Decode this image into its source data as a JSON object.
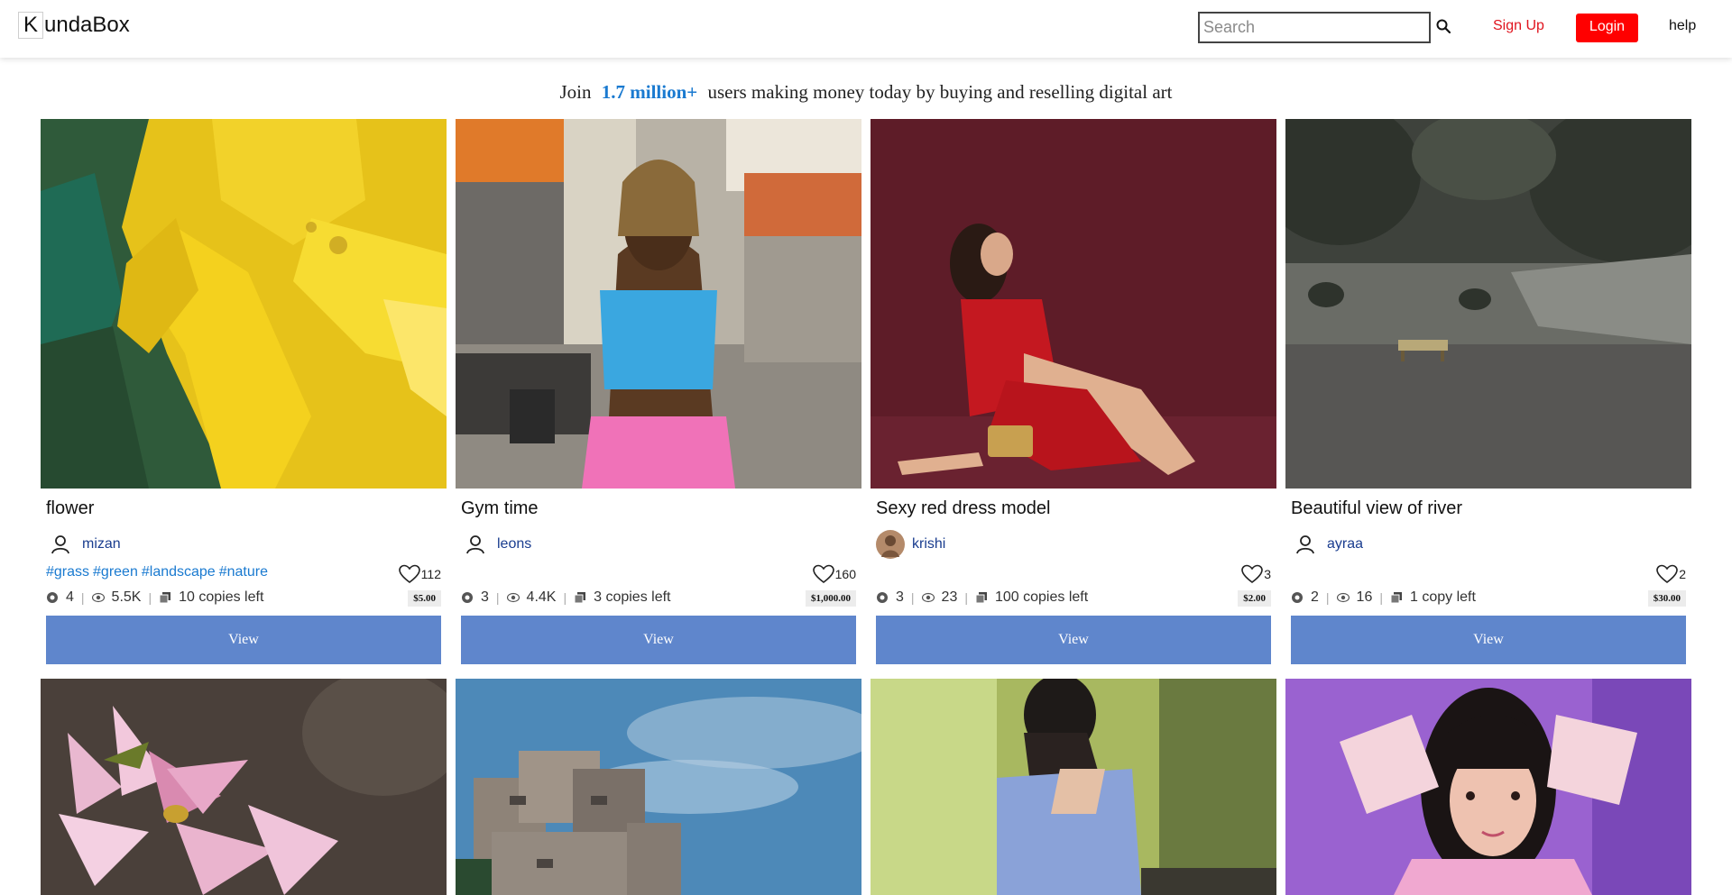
{
  "header": {
    "logo_letter": "K",
    "logo_rest": "undaBox",
    "search_placeholder": "Search",
    "signup_label": "Sign Up",
    "login_label": "Login",
    "help_label": "help"
  },
  "banner": {
    "prefix": "Join",
    "count": "1.7 million+",
    "suffix": "users making money today by buying and reselling digital art"
  },
  "colors": {
    "accent_blue": "#1a7ad0",
    "login_red": "#ff0000",
    "signup_red": "#e0141e",
    "view_button": "#5f86cc"
  },
  "cards": [
    {
      "title": "flower",
      "owner": "mizan",
      "owner_avatar": "user-icon",
      "tags": [
        "#grass",
        "#green",
        "#landscape",
        "#nature"
      ],
      "likes": "112",
      "resales": "4",
      "views": "5.5K",
      "copies": "10 copies left",
      "price": "$5.00",
      "view_label": "View",
      "image": "yellow flower photo"
    },
    {
      "title": "Gym time",
      "owner": "leons",
      "owner_avatar": "user-icon",
      "tags": [],
      "likes": "160",
      "resales": "3",
      "views": "4.4K",
      "copies": "3 copies left",
      "price": "$1,000.00",
      "view_label": "View",
      "image": "woman in gym photo"
    },
    {
      "title": "Sexy red dress model",
      "owner": "krishi",
      "owner_avatar": "profile-photo",
      "tags": [],
      "likes": "3",
      "resales": "3",
      "views": "23",
      "copies": "100 copies left",
      "price": "$2.00",
      "view_label": "View",
      "image": "model in red dress photo"
    },
    {
      "title": "Beautiful view of river",
      "owner": "ayraa",
      "owner_avatar": "user-icon",
      "tags": [],
      "likes": "2",
      "resales": "2",
      "views": "16",
      "copies": "1 copy left",
      "price": "$30.00",
      "view_label": "View",
      "image": "park with bench photo"
    }
  ],
  "row2": [
    {
      "image": "pink lotus flowers photo"
    },
    {
      "image": "concrete apartment building photo"
    },
    {
      "image": "woman in blue sweater photo"
    },
    {
      "image": "woman in pink outfit photo"
    }
  ]
}
